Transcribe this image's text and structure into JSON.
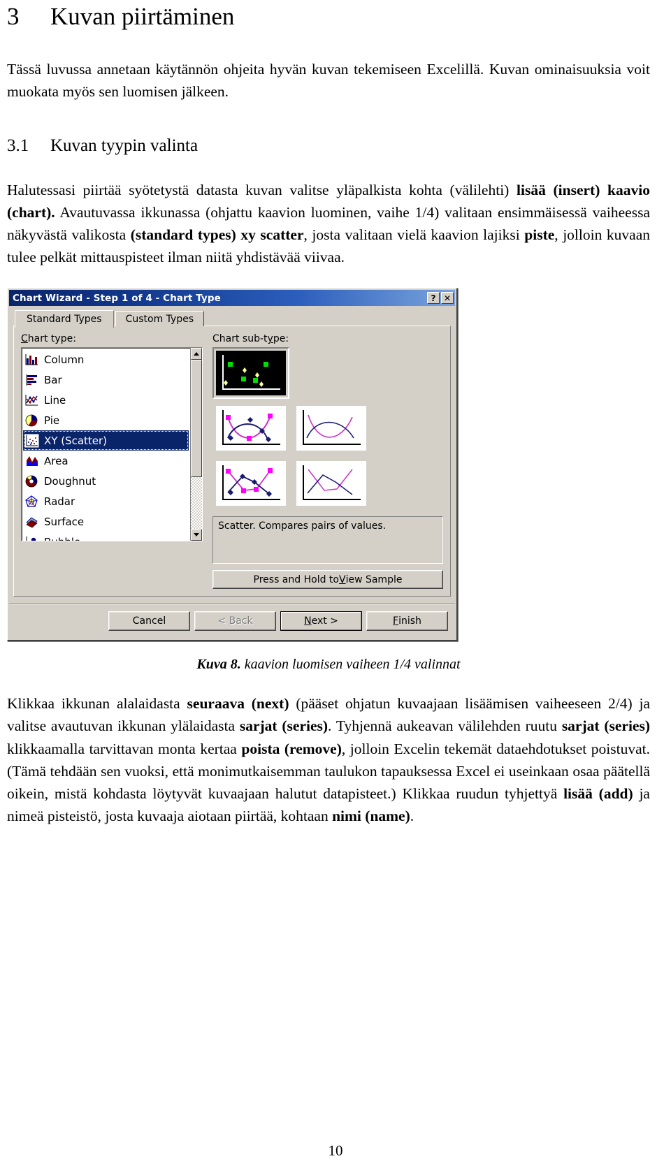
{
  "document": {
    "chapter_number": "3",
    "chapter_title": "Kuvan piirtäminen",
    "intro_paragraph": "Tässä luvussa annetaan käytännön ohjeita hyvän kuvan tekemiseen Excelillä. Kuvan ominaisuuksia voit muokata myös sen luomisen jälkeen.",
    "section_number": "3.1",
    "section_title": "Kuvan tyypin valinta",
    "para1_a": "Halutessasi piirtää syötetystä datasta kuvan valitse yläpalkista kohta (välilehti) ",
    "para1_b": "lisää (insert) kaavio (chart).",
    "para1_c": " Avautuvassa ikkunassa (ohjattu kaavion luominen, vaihe 1/4) valitaan ensimmäisessä vaiheessa näkyvästä valikosta ",
    "para1_d": "(standard types) xy scatter",
    "para1_e": ", josta valitaan vielä kaavion lajiksi ",
    "para1_f": "piste",
    "para1_g": ", jolloin kuvaan tulee pelkät mittauspisteet ilman niitä yhdistävää viivaa.",
    "caption_lead": "Kuva 8.",
    "caption_text": " kaavion luomisen vaiheen 1/4  valinnat",
    "para2_a": "Klikkaa ikkunan alalaidasta ",
    "para2_b": "seuraava (next)",
    "para2_c": " (pääset ohjatun kuvaajaan lisäämisen vaiheeseen 2/4) ja valitse avautuvan ikkunan ylälaidasta ",
    "para2_d": "sarjat (series)",
    "para2_e": ". Tyhjennä aukeavan välilehden ruutu ",
    "para2_f": "sarjat (series)",
    "para2_g": " klikkaamalla tarvittavan monta kertaa ",
    "para2_h": "poista (remove)",
    "para2_i": ", jolloin Excelin tekemät dataehdotukset poistuvat. (Tämä tehdään sen vuoksi, että monimutkaisemman taulukon tapauksessa Excel ei useinkaan osaa päätellä oikein, mistä kohdasta löytyvät kuvaajaan halutut datapisteet.) Klikkaa ruudun tyhjettyä ",
    "para2_j": "lisää (add)",
    "para2_k": " ja nimeä pisteistö, josta kuvaaja aiotaan piirtää, kohtaan ",
    "para2_l": "nimi (name)",
    "para2_m": ".",
    "page_number": "10"
  },
  "dialog": {
    "title": "Chart Wizard - Step 1 of 4 - Chart Type",
    "titlebar_buttons": [
      {
        "name": "help-button",
        "glyph": "?"
      },
      {
        "name": "close-button",
        "glyph": "✕"
      }
    ],
    "tabs": [
      {
        "label": "Standard Types",
        "active": true
      },
      {
        "label": "Custom Types",
        "active": false
      }
    ],
    "chart_type_label": "Chart type:",
    "chart_type_label_accel": "C",
    "chart_subtype_label": "Chart sub-type:",
    "chart_subtype_label_accel": "y",
    "chart_types": [
      {
        "label": "Column",
        "icon": "column-chart-icon",
        "selected": false
      },
      {
        "label": "Bar",
        "icon": "bar-chart-icon",
        "selected": false
      },
      {
        "label": "Line",
        "icon": "line-chart-icon",
        "selected": false
      },
      {
        "label": "Pie",
        "icon": "pie-chart-icon",
        "selected": false
      },
      {
        "label": "XY (Scatter)",
        "icon": "scatter-chart-icon",
        "selected": true
      },
      {
        "label": "Area",
        "icon": "area-chart-icon",
        "selected": false
      },
      {
        "label": "Doughnut",
        "icon": "doughnut-chart-icon",
        "selected": false
      },
      {
        "label": "Radar",
        "icon": "radar-chart-icon",
        "selected": false
      },
      {
        "label": "Surface",
        "icon": "surface-chart-icon",
        "selected": false
      },
      {
        "label": "Bubble",
        "icon": "bubble-chart-icon",
        "selected": false
      }
    ],
    "subtypes": [
      {
        "name": "scatter-markers-only",
        "selected": true
      },
      {
        "name": "scatter-smooth-lines-markers",
        "selected": false
      },
      {
        "name": "scatter-smooth-lines",
        "selected": false
      },
      {
        "name": "scatter-straight-lines-markers",
        "selected": false
      },
      {
        "name": "scatter-straight-lines",
        "selected": false
      }
    ],
    "description": "Scatter. Compares pairs of values.",
    "sample_button": {
      "label_before": "Press and Hold to ",
      "accel": "V",
      "label_after": "iew Sample"
    },
    "footer_buttons": [
      {
        "name": "cancel-button",
        "label": "Cancel",
        "disabled": false,
        "default": false,
        "accel": ""
      },
      {
        "name": "back-button",
        "label": "< Back",
        "disabled": true,
        "default": false,
        "accel": ""
      },
      {
        "name": "next-button",
        "label_before": "",
        "accel": "N",
        "label_after": "ext >",
        "disabled": false,
        "default": true
      },
      {
        "name": "finish-button",
        "label_before": "",
        "accel": "F",
        "label_after": "inish",
        "disabled": false,
        "default": false
      }
    ],
    "colors": {
      "titlebar_start": "#0a246a",
      "titlebar_end": "#7aa3dd",
      "face": "#d4d0c8",
      "selection": "#0a246a",
      "subtype_green": "#00d000",
      "subtype_yellow": "#ffff80",
      "subtype_magenta": "#ff00ff",
      "subtype_navy": "#000080"
    }
  }
}
